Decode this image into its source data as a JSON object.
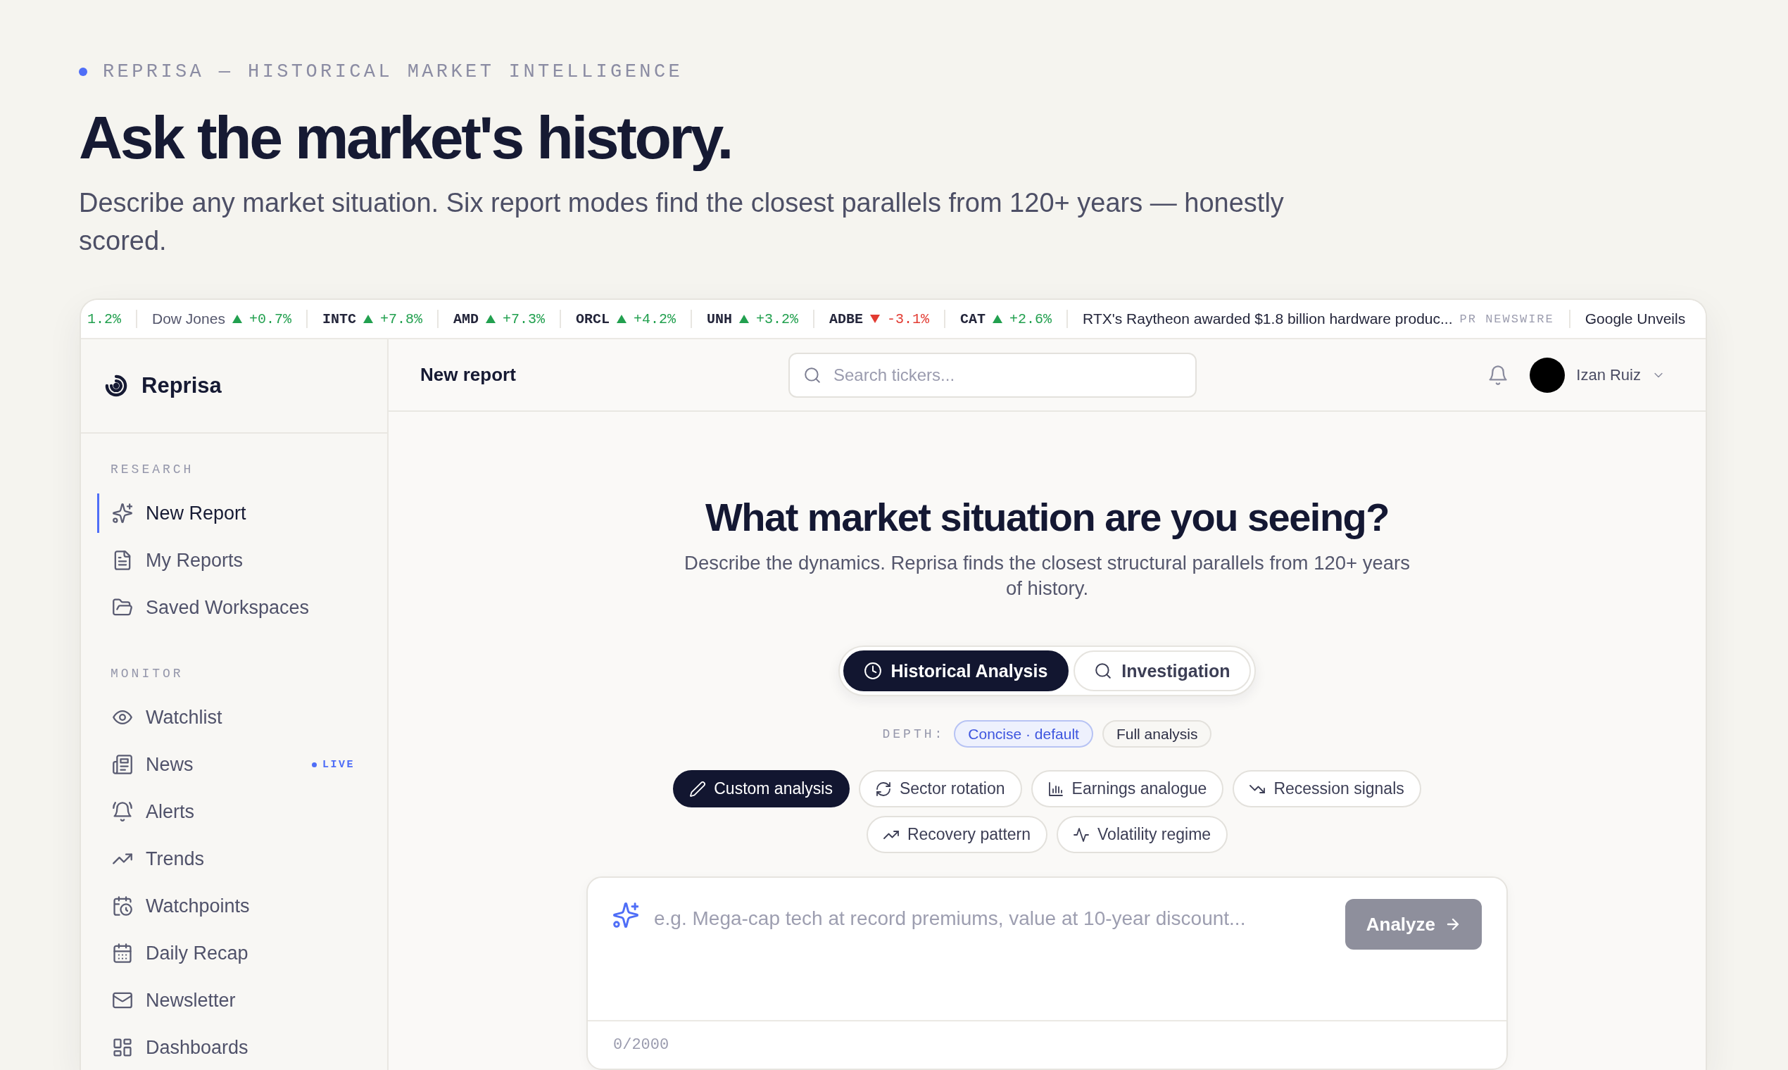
{
  "header": {
    "eyebrow": "REPRISA — HISTORICAL MARKET INTELLIGENCE",
    "title": "Ask the market's history.",
    "subtitle": "Describe any market situation. Six report modes find the closest parallels from 120+ years — honestly scored."
  },
  "ticker": [
    {
      "kind": "fragment",
      "change": "1.2%",
      "rising": true
    },
    {
      "kind": "index",
      "name": "Dow Jones",
      "change": "+0.7%",
      "rising": true
    },
    {
      "kind": "quote",
      "symbol": "INTC",
      "change": "+7.8%",
      "rising": true
    },
    {
      "kind": "quote",
      "symbol": "AMD",
      "change": "+7.3%",
      "rising": true
    },
    {
      "kind": "quote",
      "symbol": "ORCL",
      "change": "+4.2%",
      "rising": true
    },
    {
      "kind": "quote",
      "symbol": "UNH",
      "change": "+3.2%",
      "rising": true
    },
    {
      "kind": "quote",
      "symbol": "ADBE",
      "change": "-3.1%",
      "rising": false
    },
    {
      "kind": "quote",
      "symbol": "CAT",
      "change": "+2.6%",
      "rising": true
    },
    {
      "kind": "news",
      "headline": "RTX's Raytheon awarded $1.8 billion hardware produc...",
      "source": "PR NEWSWIRE"
    },
    {
      "kind": "news",
      "headline": "Google Unveils"
    }
  ],
  "sidebar": {
    "brand": "Reprisa",
    "sections": [
      {
        "label": "RESEARCH",
        "items": [
          {
            "label": "New Report",
            "selected": true
          },
          {
            "label": "My Reports",
            "selected": false
          },
          {
            "label": "Saved Workspaces",
            "selected": false
          }
        ]
      },
      {
        "label": "MONITOR",
        "items": [
          {
            "label": "Watchlist",
            "selected": false
          },
          {
            "label": "News",
            "selected": false,
            "badge": "LIVE"
          },
          {
            "label": "Alerts",
            "selected": false
          },
          {
            "label": "Trends",
            "selected": false
          },
          {
            "label": "Watchpoints",
            "selected": false
          },
          {
            "label": "Daily Recap",
            "selected": false
          },
          {
            "label": "Newsletter",
            "selected": false
          },
          {
            "label": "Dashboards",
            "selected": false
          }
        ]
      }
    ]
  },
  "topbar": {
    "title": "New report",
    "search": {
      "placeholder": "Search tickers..."
    },
    "user": {
      "name": "Izan Ruiz"
    }
  },
  "composer": {
    "title": "What market situation are you seeing?",
    "subtitle": "Describe the dynamics. Reprisa finds the closest structural parallels from 120+ years of history.",
    "modes": [
      {
        "label": "Historical Analysis",
        "selected": true
      },
      {
        "label": "Investigation",
        "selected": false
      }
    ],
    "depth": {
      "label": "DEPTH:",
      "options": [
        {
          "label": "Concise · default",
          "selected": true
        },
        {
          "label": "Full analysis",
          "selected": false
        }
      ]
    },
    "presets": [
      {
        "label": "Custom analysis",
        "selected": true
      },
      {
        "label": "Sector rotation",
        "selected": false
      },
      {
        "label": "Earnings analogue",
        "selected": false
      },
      {
        "label": "Recession signals",
        "selected": false
      },
      {
        "label": "Recovery pattern",
        "selected": false
      },
      {
        "label": "Volatility regime",
        "selected": false
      }
    ],
    "prompt": {
      "placeholder": "e.g. Mega-cap tech at record premiums, value at 10-year discount...",
      "counter": "0/2000"
    },
    "analyze": {
      "label": "Analyze",
      "disabled": true
    }
  }
}
